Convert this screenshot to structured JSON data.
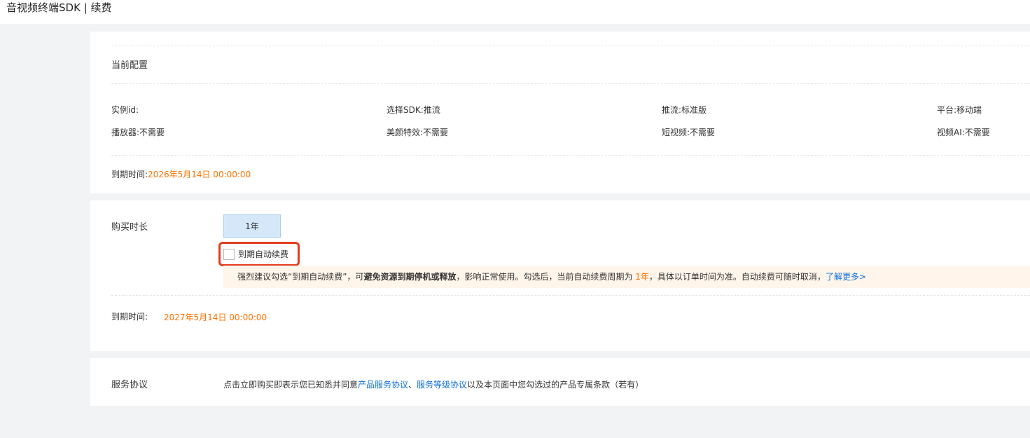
{
  "header": {
    "title": "音视频终端SDK | 续费"
  },
  "config": {
    "section_title": "当前配置",
    "fields": [
      {
        "label": "实例id:",
        "value": ""
      },
      {
        "label": "选择SDK:",
        "value": "推流"
      },
      {
        "label": "推流:",
        "value": "标准版"
      },
      {
        "label": "平台:",
        "value": "移动端"
      },
      {
        "label": "播放器:",
        "value": "不需要"
      },
      {
        "label": "美颜特效:",
        "value": "不需要"
      },
      {
        "label": "短视频:",
        "value": "不需要"
      },
      {
        "label": "视频AI:",
        "value": "不需要"
      }
    ],
    "expiry_label": "到期时间:",
    "expiry_value": "2026年5月14日 00:00:00"
  },
  "purchase": {
    "duration_label": "购买时长",
    "duration_option": "1年",
    "auto_renew_label": "到期自动续费",
    "auto_renew_checked": false,
    "notice": {
      "part1": "强烈建议勾选“到期自动续费”，可",
      "bold": "避免资源到期停机或释放",
      "part2": "，影响正常使用。勾选后，当前自动续费周期为 ",
      "period": "1年",
      "part3": "，具体以订单时间为准。自动续费可随时取消，",
      "link": "了解更多>"
    },
    "expiry_label": "到期时间:",
    "expiry_value": "2027年5月14日 00:00:00"
  },
  "agreement": {
    "label": "服务协议",
    "text1": "点击立即购买即表示您已知悉并同意",
    "link1": "产品服务协议",
    "sep": "、",
    "link2": "服务等级协议",
    "text2": "以及本页面中您勾选过的产品专属条款（若有）"
  },
  "colors": {
    "accent_orange": "#ff7200",
    "link_blue": "#0b6fd6",
    "highlight_red": "#e23c1f",
    "selected_bg": "#d5e8fa"
  }
}
